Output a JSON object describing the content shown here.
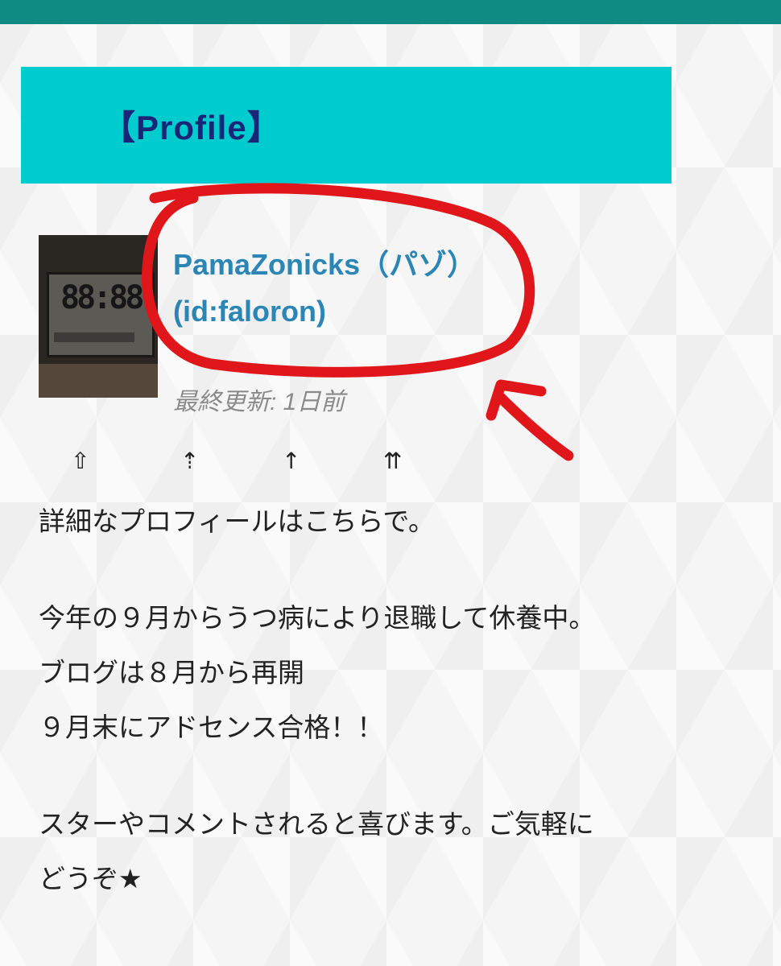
{
  "header": {
    "title": "【Profile】"
  },
  "profile": {
    "name_line1": "PamaZonicks（パゾ）",
    "name_line2": "(id:faloron)",
    "last_updated": "最終更新: 1日前",
    "avatar_digits": "88:88"
  },
  "arrows": [
    "⇧",
    "⇡",
    "↑",
    "⇈"
  ],
  "bio": {
    "detail_link": "詳細なプロフィールはこちらで。",
    "line1": "今年の９月からうつ病により退職して休養中。",
    "line2": "ブログは８月から再開",
    "line3": "９月末にアドセンス合格！！",
    "line4": "スターやコメントされると喜びます。ご気軽に",
    "line5": "どうぞ★"
  },
  "colors": {
    "top_bar": "#0e8a82",
    "header_bg": "#00cccf",
    "header_text": "#172676",
    "name_link": "#2b86b5",
    "annotation": "#e0161a"
  }
}
